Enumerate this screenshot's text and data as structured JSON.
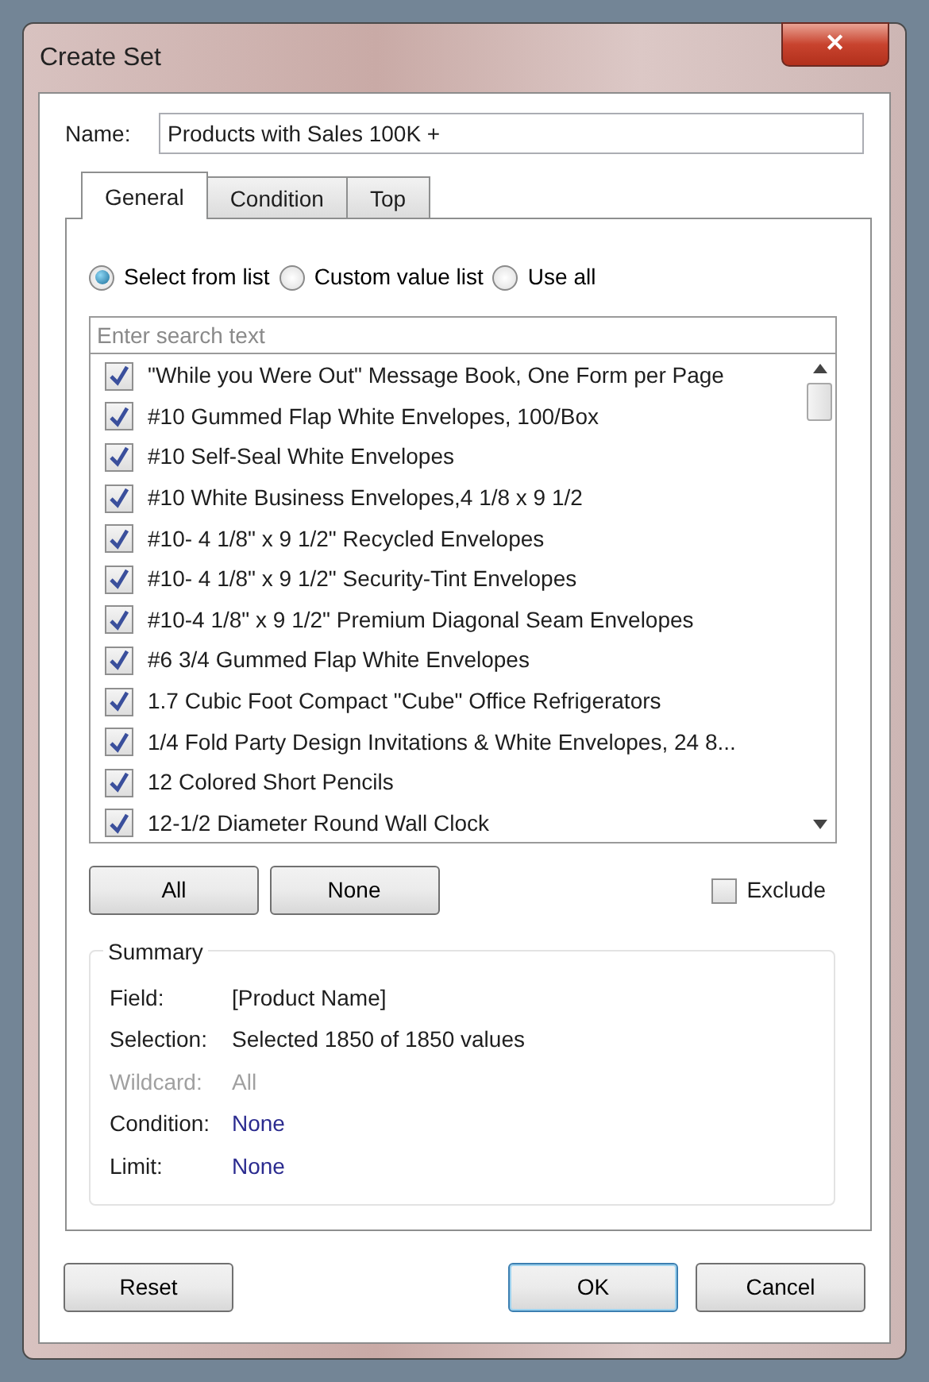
{
  "window": {
    "title": "Create Set",
    "close": "✕"
  },
  "name_field": {
    "label": "Name:",
    "value": "Products with Sales 100K +"
  },
  "tabs": [
    {
      "label": "General",
      "selected": true
    },
    {
      "label": "Condition",
      "selected": false
    },
    {
      "label": "Top",
      "selected": false
    }
  ],
  "modes": [
    {
      "label": "Select from list",
      "selected": true
    },
    {
      "label": "Custom value list",
      "selected": false
    },
    {
      "label": "Use all",
      "selected": false
    }
  ],
  "search": {
    "placeholder": "Enter search text"
  },
  "items": [
    {
      "label": "\"While you Were Out\" Message Book, One Form per Page",
      "checked": true
    },
    {
      "label": "#10 Gummed Flap White Envelopes, 100/Box",
      "checked": true
    },
    {
      "label": "#10 Self-Seal White Envelopes",
      "checked": true
    },
    {
      "label": "#10 White Business Envelopes,4 1/8 x 9 1/2",
      "checked": true
    },
    {
      "label": "#10- 4 1/8\" x 9 1/2\" Recycled Envelopes",
      "checked": true
    },
    {
      "label": "#10- 4 1/8\" x 9 1/2\" Security-Tint Envelopes",
      "checked": true
    },
    {
      "label": "#10-4 1/8\" x 9 1/2\" Premium Diagonal Seam Envelopes",
      "checked": true
    },
    {
      "label": "#6 3/4 Gummed Flap White Envelopes",
      "checked": true
    },
    {
      "label": "1.7 Cubic Foot Compact \"Cube\" Office Refrigerators",
      "checked": true
    },
    {
      "label": "1/4 Fold Party Design Invitations & White Envelopes, 24 8...",
      "checked": true
    },
    {
      "label": "12 Colored Short Pencils",
      "checked": true
    },
    {
      "label": "12-1/2 Diameter Round Wall Clock",
      "checked": true
    }
  ],
  "list_buttons": [
    "All",
    "None"
  ],
  "exclude": {
    "label": "Exclude",
    "checked": false
  },
  "summary": {
    "title": "Summary",
    "rows": [
      {
        "label": "Field:",
        "value": "[Product Name]",
        "kind": "plain"
      },
      {
        "label": "Selection:",
        "value": "Selected 1850 of 1850 values",
        "kind": "plain"
      },
      {
        "label": "Wildcard:",
        "value": "All",
        "kind": "disabled"
      },
      {
        "label": "Condition:",
        "value": "None",
        "kind": "link"
      },
      {
        "label": "Limit:",
        "value": "None",
        "kind": "link"
      }
    ]
  },
  "footer_buttons": [
    {
      "label": "Reset",
      "kind": "left",
      "default": false
    },
    {
      "label": "OK",
      "kind": "right",
      "default": true
    },
    {
      "label": "Cancel",
      "kind": "right",
      "default": false
    }
  ]
}
